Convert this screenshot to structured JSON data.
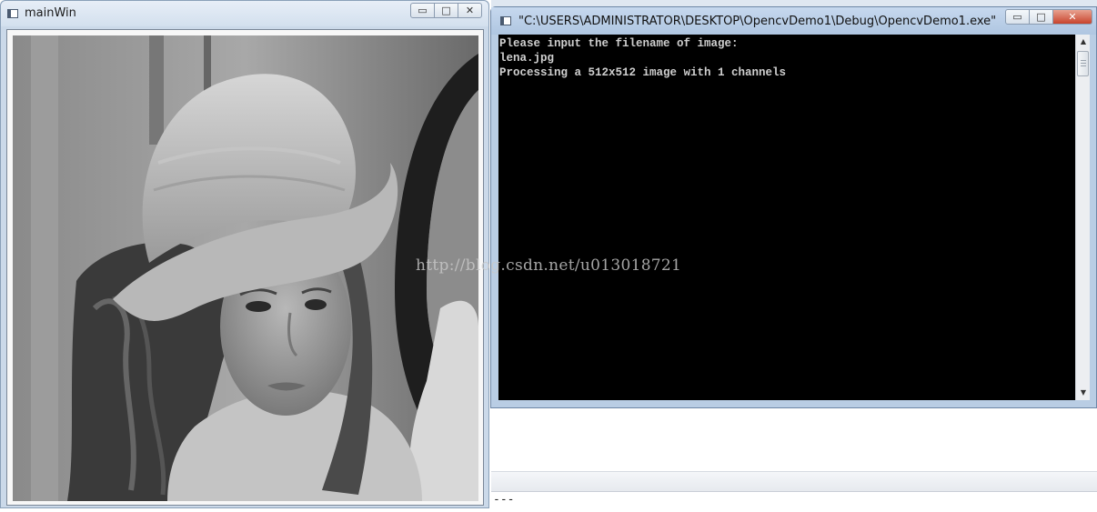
{
  "main_window": {
    "title": "mainWin",
    "image_description": "Lena test image"
  },
  "console_window": {
    "title": "\"C:\\USERS\\ADMINISTRATOR\\DESKTOP\\OpencvDemo1\\Debug\\OpencvDemo1.exe\"",
    "lines": [
      "Please input the filename of image:",
      "lena.jpg",
      "Processing a 512x512 image with 1 channels"
    ]
  },
  "caption_buttons": {
    "minimize": "▭",
    "maximize": "□",
    "close": "✕"
  },
  "background_app": {
    "output_text": "---"
  },
  "watermark": "http://blog.csdn.net/u013018721",
  "colors": {
    "console_bg": "#000000",
    "console_text": "#cfcfcf",
    "window_frame": "#cbd9e9"
  }
}
